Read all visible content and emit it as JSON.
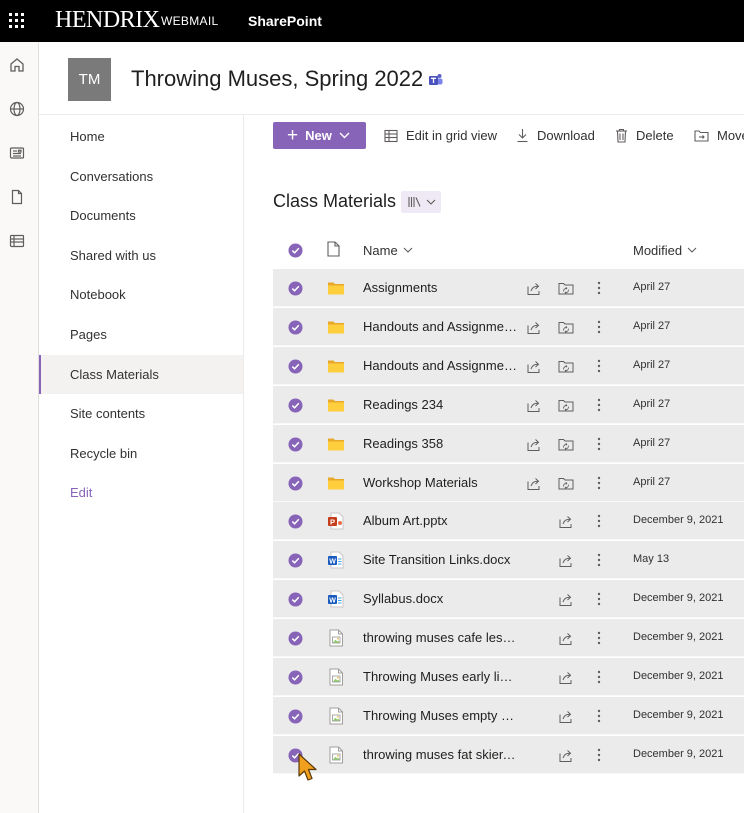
{
  "topbar": {
    "brand": "HENDRIX",
    "brand_sub": "WEBMAIL",
    "app_name": "SharePoint"
  },
  "site": {
    "logo_initials": "TM",
    "title": "Throwing Muses, Spring 2022"
  },
  "nav": {
    "items": [
      {
        "label": "Home"
      },
      {
        "label": "Conversations"
      },
      {
        "label": "Documents"
      },
      {
        "label": "Shared with us"
      },
      {
        "label": "Notebook"
      },
      {
        "label": "Pages"
      },
      {
        "label": "Class Materials",
        "selected": true
      },
      {
        "label": "Site contents"
      },
      {
        "label": "Recycle bin"
      }
    ],
    "edit_label": "Edit"
  },
  "command_bar": {
    "new_label": "New",
    "grid_view_label": "Edit in grid view",
    "download_label": "Download",
    "delete_label": "Delete",
    "move_label": "Move"
  },
  "library": {
    "title": "Class Materials",
    "columns": {
      "name": "Name",
      "modified": "Modified"
    },
    "rows": [
      {
        "name": "Assignments",
        "type": "folder",
        "modified": "April 27"
      },
      {
        "name": "Handouts and Assignments",
        "type": "folder",
        "modified": "April 27"
      },
      {
        "name": "Handouts and Assignments",
        "type": "folder",
        "modified": "April 27"
      },
      {
        "name": "Readings 234",
        "type": "folder",
        "modified": "April 27"
      },
      {
        "name": "Readings 358",
        "type": "folder",
        "modified": "April 27"
      },
      {
        "name": "Workshop Materials",
        "type": "folder",
        "modified": "April 27"
      },
      {
        "name": "Album Art.pptx",
        "type": "pptx",
        "modified": "December 9, 2021"
      },
      {
        "name": "Site Transition Links.docx",
        "type": "docx",
        "modified": "May 13"
      },
      {
        "name": "Syllabus.docx",
        "type": "docx",
        "modified": "December 9, 2021"
      },
      {
        "name": "throwing muses cafe leslie front.jpg",
        "type": "image",
        "modified": "December 9, 2021"
      },
      {
        "name": "Throwing Muses early live.jpg",
        "type": "image",
        "modified": "December 9, 2021"
      },
      {
        "name": "Throwing Muses empty gym.jpg",
        "type": "image",
        "modified": "December 9, 2021"
      },
      {
        "name": "throwing muses fat skier.jpg",
        "type": "image",
        "modified": "December 9, 2021"
      }
    ]
  },
  "colors": {
    "accent": "#8764b8",
    "folder": "#ffce3d",
    "row_selected_bg": "#ebebeb",
    "topbar_bg": "#000000"
  }
}
